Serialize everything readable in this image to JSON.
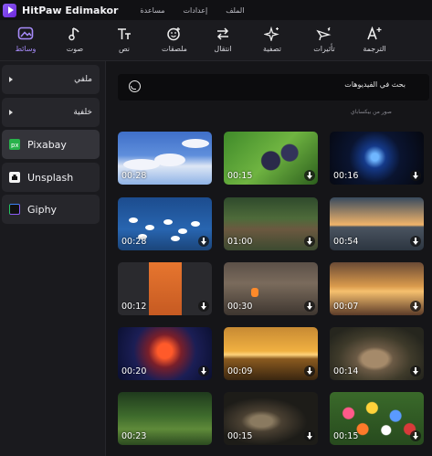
{
  "app": {
    "title": "HitPaw Edimakor"
  },
  "menu": [
    "الملف",
    "إعدادات",
    "مساعدة"
  ],
  "toolbar": {
    "tools": [
      {
        "id": "media",
        "label": "وسائط",
        "icon": "media-icon",
        "active": true
      },
      {
        "id": "audio",
        "label": "صوت",
        "icon": "music-note-icon"
      },
      {
        "id": "text",
        "label": "نص",
        "icon": "text-icon"
      },
      {
        "id": "stickers",
        "label": "ملصقات",
        "icon": "sticker-icon"
      },
      {
        "id": "transition",
        "label": "انتقال",
        "icon": "transition-arrows-icon"
      },
      {
        "id": "filter",
        "label": "تصفية",
        "icon": "sparkle-icon"
      },
      {
        "id": "effects",
        "label": "تأثيرات",
        "icon": "effects-icon"
      },
      {
        "id": "translate",
        "label": "الترجمة",
        "icon": "translate-text-icon"
      }
    ]
  },
  "sidebar": {
    "items": [
      {
        "label": "ملفي",
        "type": "expandable"
      },
      {
        "label": "خلفية",
        "type": "expandable"
      },
      {
        "label": "Pixabay",
        "type": "source",
        "active": true,
        "icon_color": "#28b24b"
      },
      {
        "label": "Unsplash",
        "type": "source",
        "icon_color": "#f4f4f4"
      },
      {
        "label": "Giphy",
        "type": "source",
        "icon_color": "#8b5cf6"
      }
    ]
  },
  "search": {
    "placeholder": "بحث في الفيديوهات"
  },
  "credit": "صور من بيكساباي",
  "videos": [
    {
      "duration": "00:28",
      "scene": "blue sky with clouds"
    },
    {
      "duration": "00:15",
      "scene": "grapes on vine"
    },
    {
      "duration": "00:16",
      "scene": "cosmic human silhouette"
    },
    {
      "duration": "00:28",
      "scene": "swans on lake"
    },
    {
      "duration": "01:00",
      "scene": "forest cabin"
    },
    {
      "duration": "00:54",
      "scene": "sunset over sea"
    },
    {
      "duration": "00:12",
      "scene": "orange vertical video"
    },
    {
      "duration": "00:30",
      "scene": "cozy porch with fireplace"
    },
    {
      "duration": "00:07",
      "scene": "golden clouds"
    },
    {
      "duration": "00:20",
      "scene": "robot with fire"
    },
    {
      "duration": "00:09",
      "scene": "golden sunset over water"
    },
    {
      "duration": "00:14",
      "scene": "rabbit on rocks"
    },
    {
      "duration": "00:23",
      "scene": "green forest"
    },
    {
      "duration": "00:15",
      "scene": "squirrel on tree"
    },
    {
      "duration": "00:15",
      "scene": "colorful flowers"
    }
  ]
}
